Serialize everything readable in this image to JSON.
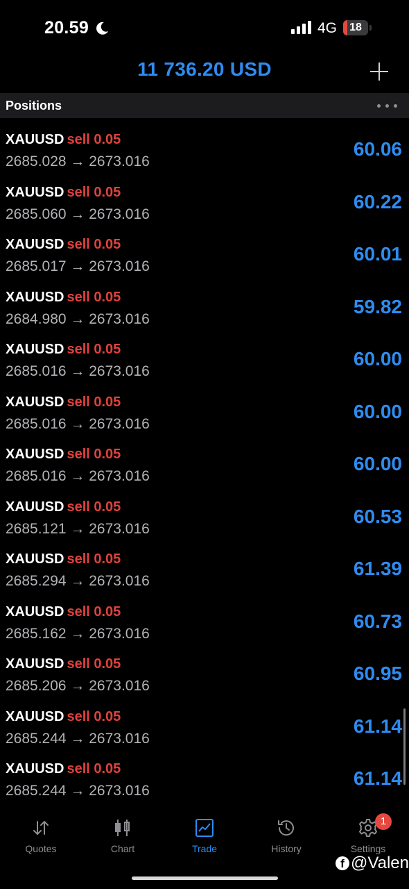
{
  "status_bar": {
    "time": "20.59",
    "network": "4G",
    "battery_level": "18",
    "battery_fraction": 0.18
  },
  "header": {
    "balance": "11 736.20 USD"
  },
  "section": {
    "title": "Positions"
  },
  "positions": [
    {
      "symbol": "XAUUSD",
      "side": "sell 0.05",
      "prices": "2685.028 → 2673.016",
      "profit": "60.06"
    },
    {
      "symbol": "XAUUSD",
      "side": "sell 0.05",
      "prices": "2685.060 → 2673.016",
      "profit": "60.22"
    },
    {
      "symbol": "XAUUSD",
      "side": "sell 0.05",
      "prices": "2685.017 → 2673.016",
      "profit": "60.01"
    },
    {
      "symbol": "XAUUSD",
      "side": "sell 0.05",
      "prices": "2684.980 → 2673.016",
      "profit": "59.82"
    },
    {
      "symbol": "XAUUSD",
      "side": "sell 0.05",
      "prices": "2685.016 → 2673.016",
      "profit": "60.00"
    },
    {
      "symbol": "XAUUSD",
      "side": "sell 0.05",
      "prices": "2685.016 → 2673.016",
      "profit": "60.00"
    },
    {
      "symbol": "XAUUSD",
      "side": "sell 0.05",
      "prices": "2685.016 → 2673.016",
      "profit": "60.00"
    },
    {
      "symbol": "XAUUSD",
      "side": "sell 0.05",
      "prices": "2685.121 → 2673.016",
      "profit": "60.53"
    },
    {
      "symbol": "XAUUSD",
      "side": "sell 0.05",
      "prices": "2685.294 → 2673.016",
      "profit": "61.39"
    },
    {
      "symbol": "XAUUSD",
      "side": "sell 0.05",
      "prices": "2685.162 → 2673.016",
      "profit": "60.73"
    },
    {
      "symbol": "XAUUSD",
      "side": "sell 0.05",
      "prices": "2685.206 → 2673.016",
      "profit": "60.95"
    },
    {
      "symbol": "XAUUSD",
      "side": "sell 0.05",
      "prices": "2685.244 → 2673.016",
      "profit": "61.14"
    },
    {
      "symbol": "XAUUSD",
      "side": "sell 0.05",
      "prices": "2685.244 → 2673.016",
      "profit": "61.14"
    }
  ],
  "tabs": [
    {
      "label": "Quotes",
      "icon": "quotes-arrows-icon",
      "active": false
    },
    {
      "label": "Chart",
      "icon": "candlestick-icon",
      "active": false
    },
    {
      "label": "Trade",
      "icon": "trade-chart-icon",
      "active": true
    },
    {
      "label": "History",
      "icon": "history-clock-icon",
      "active": false
    },
    {
      "label": "Settings",
      "icon": "gear-icon",
      "active": false,
      "badge": "1"
    }
  ],
  "watermark": {
    "text": "@Valen",
    "icon": "facebook-icon"
  },
  "colors": {
    "accent": "#2e8cf0",
    "sell": "#e0413c",
    "background": "#000000",
    "section_bg": "#1c1c1e",
    "muted": "#8e8e93"
  }
}
